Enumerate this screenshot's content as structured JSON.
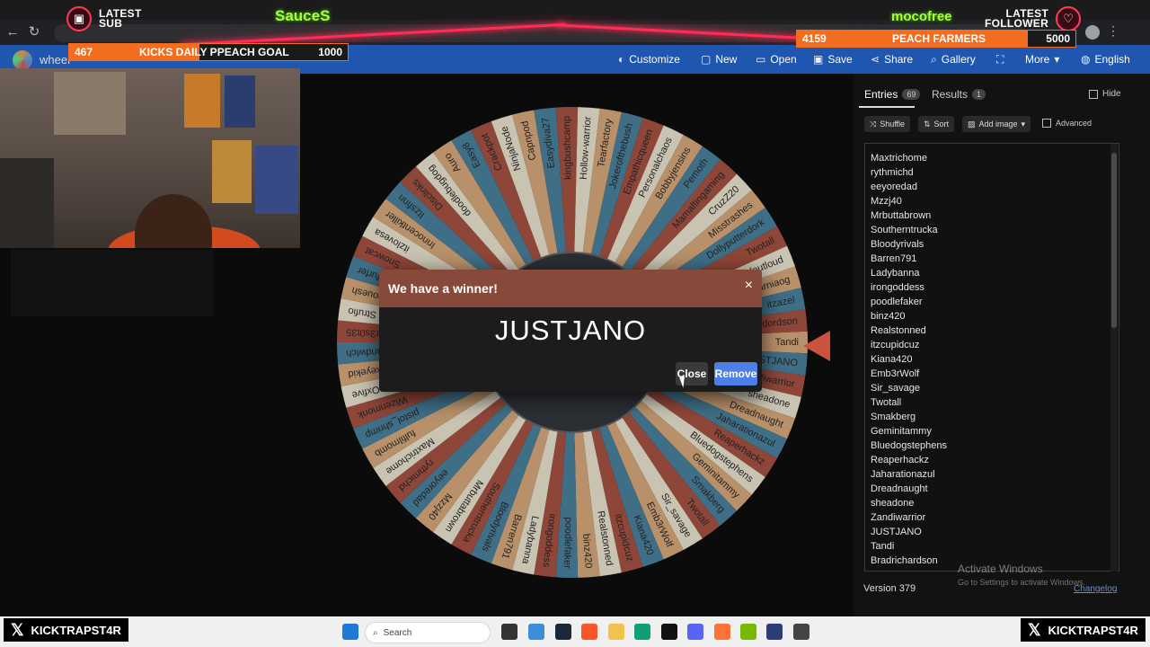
{
  "overlay": {
    "latest_sub_label": "LATEST\nSUB",
    "ticker_left": "SauceS",
    "ticker_right": "mocofree",
    "latest_follower_label": "LATEST\nFOLLOWER",
    "goal_left": {
      "current": "467",
      "label": "KICKS DAILY PPEACH GOAL",
      "target": "1000",
      "progress": 0.467
    },
    "goal_right": {
      "current": "4159",
      "label": "PEACH FARMERS",
      "target": "5000",
      "progress": 0.83
    },
    "x_handle_left": "KICKTRAPST4R",
    "x_handle_right": "KICKTRAPST4R"
  },
  "app": {
    "title": "wheel",
    "menu": [
      {
        "icon": "palette-icon",
        "glyph": "◐",
        "label": "Customize"
      },
      {
        "icon": "file-icon",
        "glyph": "▢",
        "label": "New"
      },
      {
        "icon": "folder-icon",
        "glyph": "▭",
        "label": "Open"
      },
      {
        "icon": "save-icon",
        "glyph": "▣",
        "label": "Save"
      },
      {
        "icon": "share-icon",
        "glyph": "⋖",
        "label": "Share"
      },
      {
        "icon": "search-icon",
        "glyph": "⌕",
        "label": "Gallery"
      },
      {
        "icon": "fullscreen-icon",
        "glyph": "⛶",
        "label": ""
      },
      {
        "icon": "chevron-down-icon",
        "glyph": "▾",
        "label": "More"
      },
      {
        "icon": "globe-icon",
        "glyph": "◍",
        "label": "English"
      }
    ]
  },
  "dialog": {
    "title": "We have a winner!",
    "winner": "JUSTJANO",
    "close_label": "Close",
    "remove_label": "Remove",
    "x_glyph": "×"
  },
  "panel": {
    "tab_entries": "Entries",
    "entries_count": "69",
    "tab_results": "Results",
    "results_count": "1",
    "hide_label": "Hide",
    "shuffle_label": "Shuffle",
    "sort_label": "Sort",
    "add_image_label": "Add image",
    "advanced_label": "Advanced",
    "entries": [
      "Maxtrichome",
      "rythmichd",
      "eeyoredad",
      "Mzzj40",
      "Mrbuttabrown",
      "Southerntrucka",
      "Bloodyrivals",
      "Barren791",
      "Ladybanna",
      "irongoddess",
      "poodlefaker",
      "binz420",
      "Realstonned",
      "itzcupidcuz",
      "Kiana420",
      "Emb3rWolf",
      "Sir_savage",
      "Twotall",
      "Smakberg",
      "Geminitammy",
      "Bluedogstephens",
      "Reaperhackz",
      "Jaharationazul",
      "Dreadnaught",
      "sheadone",
      "Zandiwarrior",
      "JUSTJANO",
      "Tandi",
      "Bradrichardson"
    ],
    "version": "Version 379",
    "changelog": "Changelog",
    "activate_title": "Activate Windows",
    "activate_sub": "Go to Settings to activate Windows."
  },
  "wheel": {
    "colors": [
      "#b8916a",
      "#3f6f87",
      "#8e4638",
      "#c9c3b2"
    ],
    "labels": [
      "Tandi",
      "JUSTJANO",
      "Zandiwarrior",
      "sheadone",
      "Dreadnaught",
      "Jaharationazul",
      "Reaperhackz",
      "Bluedogstephens",
      "Geminitammy",
      "Smakberg",
      "Twotall",
      "Sir_savage",
      "Emb3rWolf",
      "Kiana420",
      "itzcupidcuz",
      "Realstonned",
      "binz420",
      "poodlefaker",
      "irongoddess",
      "Ladybanna",
      "Barren791",
      "Bloodyrivals",
      "Southerntrucka",
      "Mrbuttabrown",
      "Mzzj40",
      "eeyoredad",
      "rythmichd",
      "Maxtrichome",
      "fulfilmomb",
      "pistol_shrimp",
      "Wizenmonk",
      "Oxfive",
      "blackeyekid",
      "Sandwlch",
      "Fr3s0t35",
      "Strufio",
      "Maouesh",
      "Itzfurfer",
      "Snowcat",
      "itzlovesa",
      "Innocentkiller",
      "Itzsfinn",
      "Disclinks",
      "doodlebugdog",
      "Auro",
      "Easy8",
      "Crackpot",
      "NinjaNode",
      "Capnpod",
      "Easydiva27",
      "kingbushcamp",
      "Hollow-warrior",
      "Tearfactory",
      "Jokerofthebush",
      "Empathicqueen",
      "Personalchaos",
      "Bobbyjensins",
      "Pemoth",
      "Mamaltingaming",
      "CruzZ20",
      "Misstrashes",
      "Dollyputterdork",
      "Twotall",
      "pearloutloud",
      "Starniaog",
      "itzazel",
      "Fildsmpdordson"
    ]
  },
  "taskbar": {
    "search_placeholder": "Search"
  }
}
